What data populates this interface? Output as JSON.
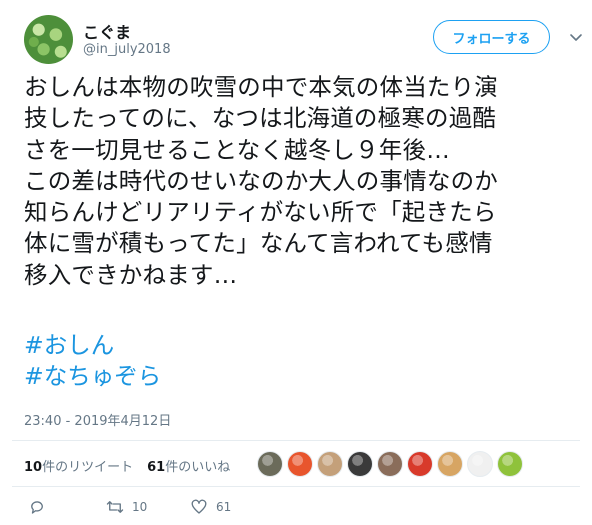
{
  "user": {
    "display_name": "こぐま",
    "handle": "@in_july2018",
    "follow_label": "フォローする"
  },
  "tweet": {
    "text": "おしんは本物の吹雪の中で本気の体当たり演\n技したってのに、なつは北海道の極寒の過酷\nさを一切見せることなく越冬し９年後…\nこの差は時代のせいなのか大人の事情なのか\n知らんけどリアリティがない所で「起きたら\n体に雪が積もってた」なんて言われても感情\n移入できかねます…",
    "hashtags": [
      "#おしん",
      "#なちゅぞら"
    ],
    "timestamp": "23:40 - 2019年4月12日"
  },
  "stats": {
    "retweets_count": "10",
    "retweets_label": "件のリツイート",
    "likes_count": "61",
    "likes_label": "件のいいね"
  },
  "likers": [
    {
      "icon": "liker-avatar-1",
      "color": "#6b6b5a"
    },
    {
      "icon": "liker-avatar-2",
      "color": "#e8552d"
    },
    {
      "icon": "liker-avatar-3",
      "color": "#c4a07a"
    },
    {
      "icon": "liker-avatar-4",
      "color": "#3a3a3a"
    },
    {
      "icon": "liker-avatar-5",
      "color": "#8a6d5a"
    },
    {
      "icon": "liker-avatar-6",
      "color": "#d83a2b"
    },
    {
      "icon": "liker-avatar-7",
      "color": "#d7a563"
    },
    {
      "icon": "liker-avatar-8",
      "color": "#f0f0f0"
    },
    {
      "icon": "liker-avatar-9",
      "color": "#8fc23b"
    }
  ],
  "actions": {
    "reply_icon": "reply-icon",
    "retweet_count": "10",
    "like_count": "61"
  },
  "colors": {
    "accent": "#1da1f2",
    "hashtag": "#1b95e0",
    "secondary_text": "#657786"
  }
}
